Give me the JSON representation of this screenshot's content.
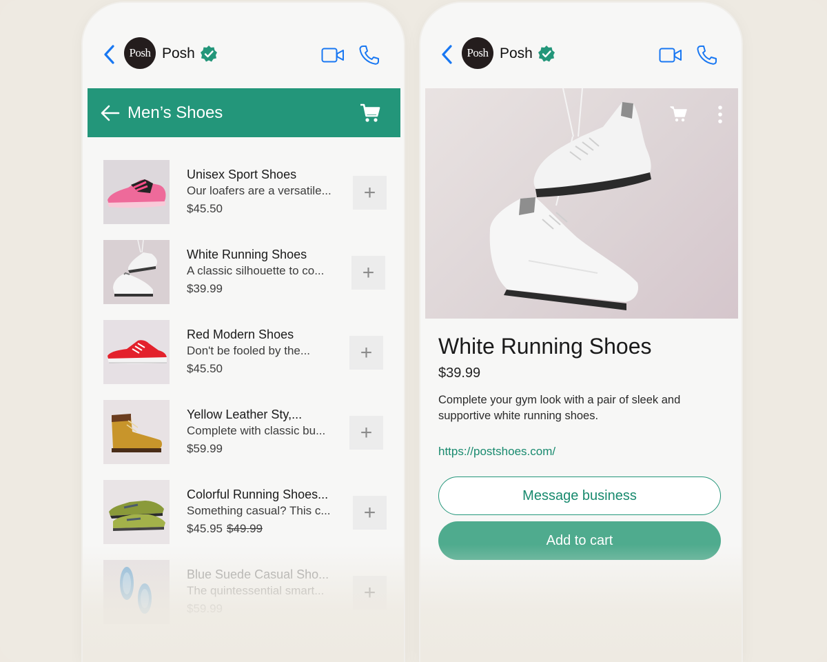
{
  "colors": {
    "accent": "#23967a",
    "link": "#188a6e",
    "ios_blue": "#1877f2"
  },
  "chat": {
    "business_name": "Posh",
    "avatar_text": "Posh"
  },
  "catalog": {
    "title": "Men’s Shoes",
    "products": [
      {
        "name": "Unisex Sport Shoes",
        "desc": "Our loafers are a versatile...",
        "price": "$45.50",
        "old_price": ""
      },
      {
        "name": "White Running Shoes",
        "desc": "A classic silhouette to co...",
        "price": "$39.99",
        "old_price": ""
      },
      {
        "name": "Red Modern Shoes",
        "desc": "Don't be fooled by the...",
        "price": "$45.50",
        "old_price": ""
      },
      {
        "name": "Yellow Leather Sty,...",
        "desc": "Complete with classic bu...",
        "price": "$59.99",
        "old_price": ""
      },
      {
        "name": "Colorful Running Shoes...",
        "desc": "Something casual? This c...",
        "price": "$45.95",
        "old_price": "$49.99"
      },
      {
        "name": "Blue Suede Casual Sho...",
        "desc": "The quintessential smart...",
        "price": "$59.99",
        "old_price": ""
      }
    ],
    "add_label": "+"
  },
  "detail": {
    "title": "White Running Shoes",
    "price": "$39.99",
    "description": "Complete your gym look with a pair of sleek and supportive white running shoes.",
    "link": "https://postshoes.com/",
    "message_label": "Message business",
    "cart_label": "Add to cart"
  }
}
